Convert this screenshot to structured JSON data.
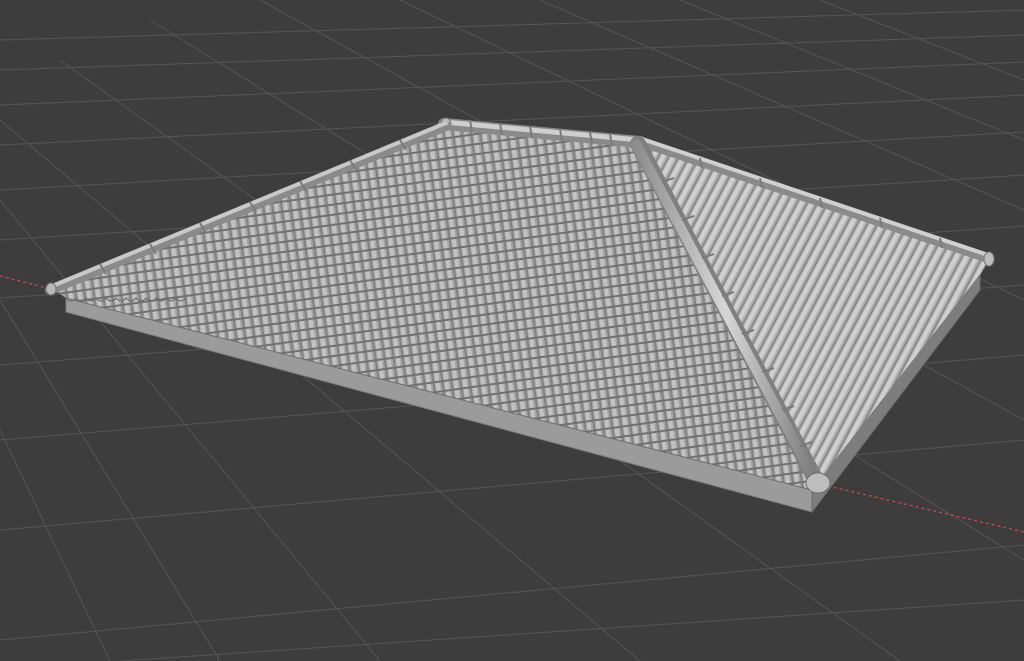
{
  "app": {
    "name": "3D Viewport"
  },
  "scene": {
    "object": "hip-roof-with-clay-tiles",
    "background_color": "#3d3d3d",
    "grid_line_color": "#555555",
    "x_axis_color": "#d0454b",
    "mesh_color": "#9b9b9b",
    "mesh_highlight_color": "#c9c9c9",
    "mesh_shadow_color": "#6e6e6e"
  }
}
